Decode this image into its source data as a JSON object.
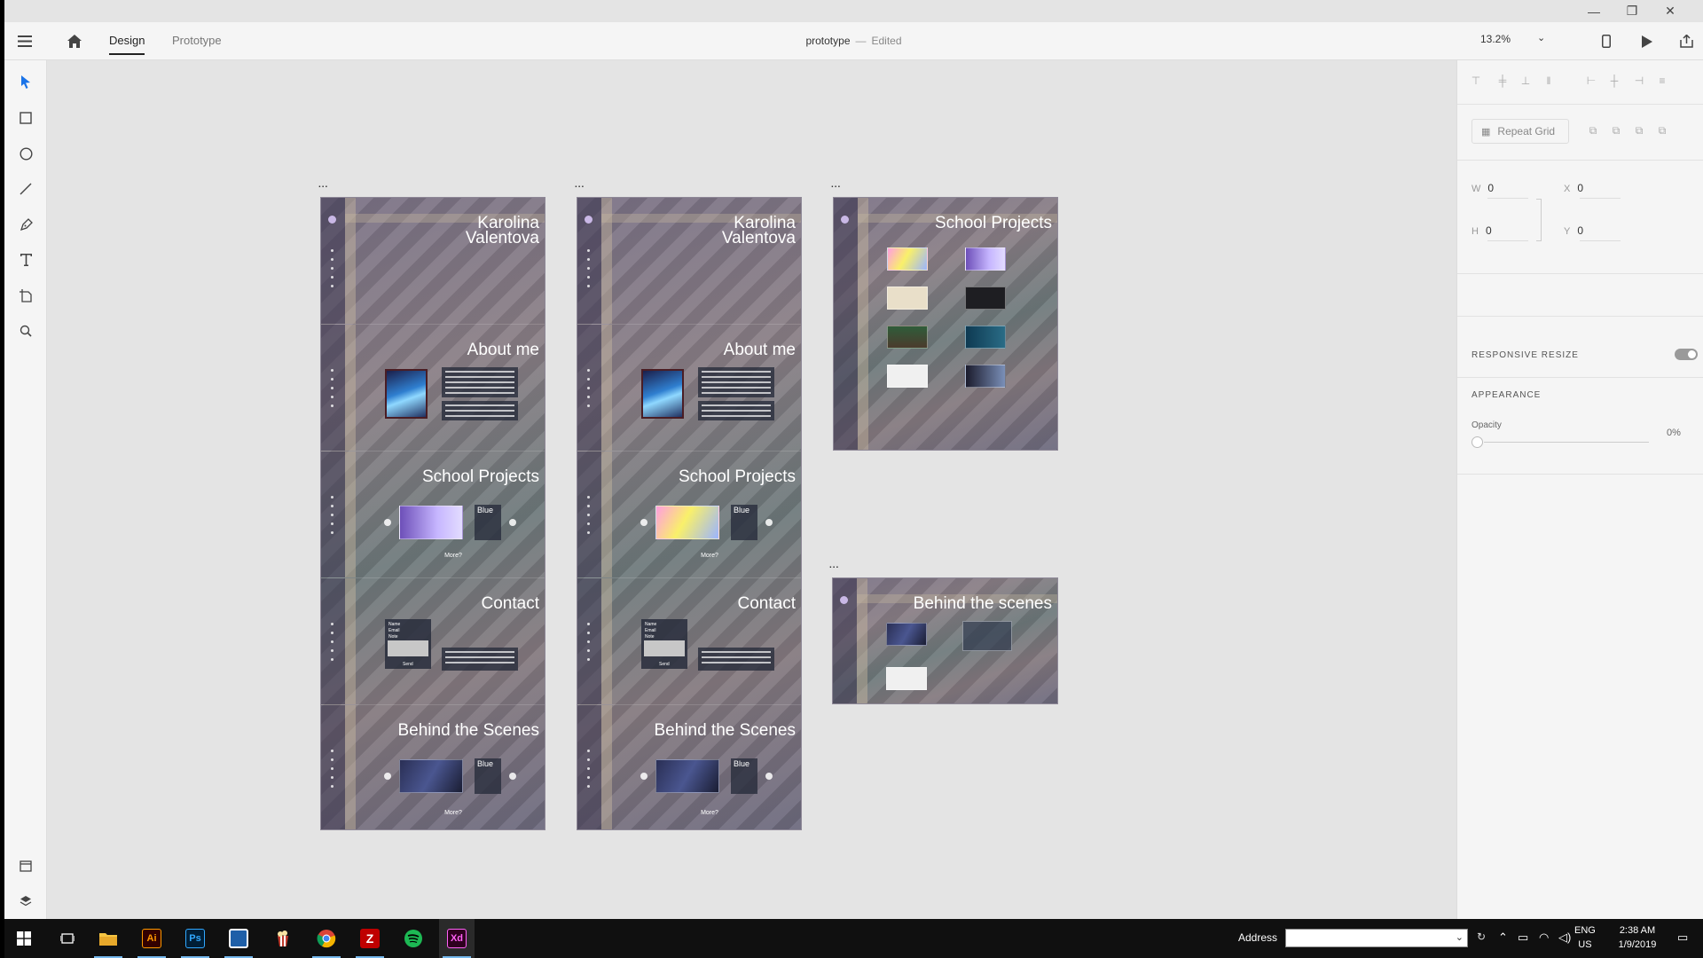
{
  "window": {
    "controls": {
      "minimize": "—",
      "restore": "❐",
      "close": "✕"
    }
  },
  "appbar": {
    "tabs": [
      {
        "label": "Design",
        "active": true
      },
      {
        "label": "Prototype",
        "active": false
      }
    ],
    "document": {
      "name": "prototype",
      "separator": "—",
      "status": "Edited"
    },
    "zoom": "13.2%"
  },
  "toolbar": {
    "tools": [
      "select-tool",
      "rectangle-tool",
      "ellipse-tool",
      "line-tool",
      "pen-tool",
      "text-tool",
      "artboard-tool",
      "zoom-tool"
    ],
    "bottom": [
      "assets-panel",
      "layers-panel"
    ]
  },
  "canvas": {
    "artboards": [
      {
        "label": "...",
        "sections": [
          {
            "title": "Karolina Valentova",
            "kind": "hero"
          },
          {
            "title": "About me",
            "kind": "about"
          },
          {
            "title": "School Projects",
            "kind": "slider",
            "slide": "purple",
            "caption": "Blue",
            "more": "More?"
          },
          {
            "title": "Contact",
            "kind": "contact",
            "form_labels": [
              "Name",
              "Email",
              "Note"
            ],
            "send": "Send"
          },
          {
            "title": "Behind the Scenes",
            "kind": "slider",
            "slide": "dark",
            "caption": "Blue",
            "more": "More?"
          }
        ]
      },
      {
        "label": "...",
        "sections": [
          {
            "title": "Karolina Valentova",
            "kind": "hero"
          },
          {
            "title": "About me",
            "kind": "about"
          },
          {
            "title": "School Projects",
            "kind": "slider",
            "slide": "yellow",
            "caption": "Blue",
            "more": "More?"
          },
          {
            "title": "Contact",
            "kind": "contact",
            "form_labels": [
              "Name",
              "Email",
              "Note"
            ],
            "send": "Send"
          },
          {
            "title": "Behind the Scenes",
            "kind": "slider",
            "slide": "dark",
            "caption": "Blue",
            "more": "More?"
          }
        ]
      },
      {
        "label": "...",
        "title": "School Projects"
      },
      {
        "label": "...",
        "title": "Behind the scenes"
      }
    ]
  },
  "properties": {
    "repeat_grid": "Repeat Grid",
    "w_label": "W",
    "w_value": "0",
    "h_label": "H",
    "h_value": "0",
    "x_label": "X",
    "x_value": "0",
    "y_label": "Y",
    "y_value": "0",
    "responsive_resize": "RESPONSIVE RESIZE",
    "appearance": "APPEARANCE",
    "opacity_label": "Opacity",
    "opacity_value": "0%"
  },
  "taskbar": {
    "apps": [
      {
        "name": "start"
      },
      {
        "name": "task-view"
      },
      {
        "name": "file-explorer"
      },
      {
        "name": "illustrator",
        "text": "Ai",
        "color": "#ff9a00",
        "bg": "#330000"
      },
      {
        "name": "photoshop",
        "text": "Ps",
        "color": "#31a8ff",
        "bg": "#001e36"
      },
      {
        "name": "app-blue",
        "color": "#ffffff",
        "bg": "#1e5fa8"
      },
      {
        "name": "popcorn",
        "color": "#ffffff",
        "bg": "#c0392b"
      },
      {
        "name": "chrome"
      },
      {
        "name": "filezilla",
        "color": "#ffffff",
        "bg": "#bf0000"
      },
      {
        "name": "spotify",
        "color": "#000000",
        "bg": "#1db954"
      },
      {
        "name": "xd",
        "text": "Xd",
        "color": "#ff61f6",
        "bg": "#2e001f"
      }
    ],
    "address_label": "Address",
    "address_value": "",
    "lang_top": "ENG",
    "lang_bottom": "US",
    "time": "2:38 AM",
    "date": "1/9/2019"
  }
}
